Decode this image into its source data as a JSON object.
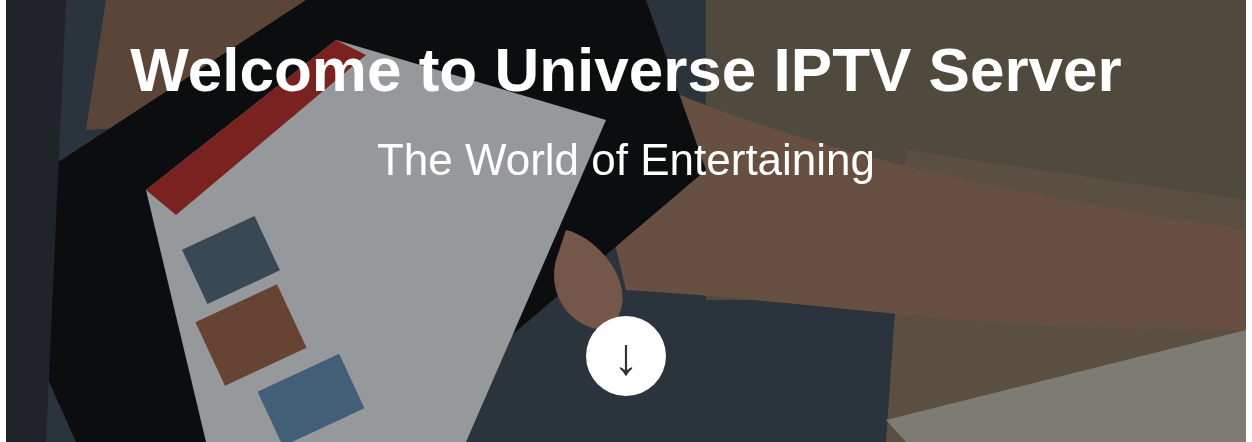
{
  "hero": {
    "title": "Welcome to Universe IPTV Server",
    "subtitle": "The World of Entertaining",
    "scroll_button": {
      "icon": "↓"
    }
  }
}
